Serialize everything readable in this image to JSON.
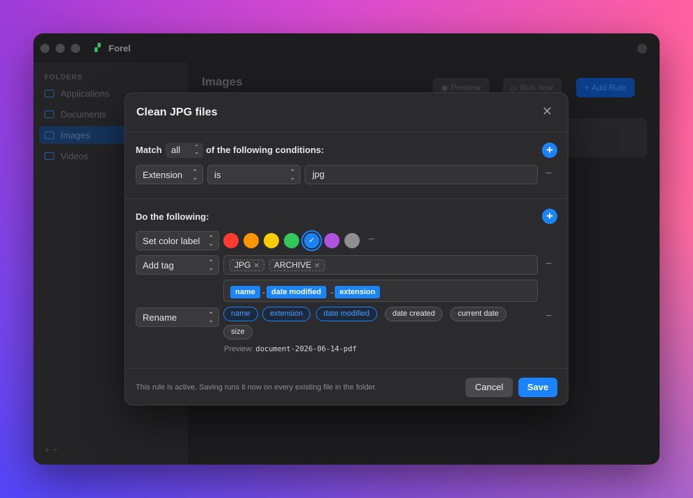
{
  "app": {
    "title": "Forel"
  },
  "sidebar": {
    "heading": "FOLDERS",
    "items": [
      {
        "label": "Applications",
        "active": false
      },
      {
        "label": "Documents",
        "active": false
      },
      {
        "label": "Images",
        "active": true
      },
      {
        "label": "Videos",
        "active": false
      }
    ],
    "bottom": "+ −"
  },
  "main": {
    "title": "Images",
    "toolbar": {
      "preview": "Preview",
      "run_now": "Run now",
      "add_rule": "Add Rule"
    }
  },
  "modal": {
    "title": "Clean JPG files",
    "conditions": {
      "match_prefix": "Match",
      "match_value": "all",
      "match_suffix": "of the following conditions:",
      "field": "Extension",
      "operator": "is",
      "value": "jpg"
    },
    "actions": {
      "heading": "Do the following:",
      "color_label": {
        "action": "Set color label",
        "colors": [
          "#ff3b30",
          "#ff9500",
          "#ffcc00",
          "#34c759",
          "#1a84ff",
          "#af52de",
          "#8e8e93"
        ],
        "selected_index": 4
      },
      "add_tag": {
        "action": "Add tag",
        "tags": [
          "JPG",
          "ARCHIVE"
        ]
      },
      "rename": {
        "action": "Rename",
        "pattern": [
          "name",
          "date modified",
          "extension"
        ],
        "separator": "-",
        "tokens": [
          {
            "label": "name",
            "active": true
          },
          {
            "label": "extension",
            "active": true
          },
          {
            "label": "date modified",
            "active": true
          },
          {
            "label": "date created",
            "active": false
          },
          {
            "label": "current date",
            "active": false
          },
          {
            "label": "size",
            "active": false
          }
        ],
        "preview_label": "Preview:",
        "preview_value": "document-2026-06-14-pdf"
      }
    },
    "footer": {
      "note": "This rule is active. Saving runs it now on every existing file in the folder.",
      "cancel": "Cancel",
      "save": "Save"
    }
  }
}
